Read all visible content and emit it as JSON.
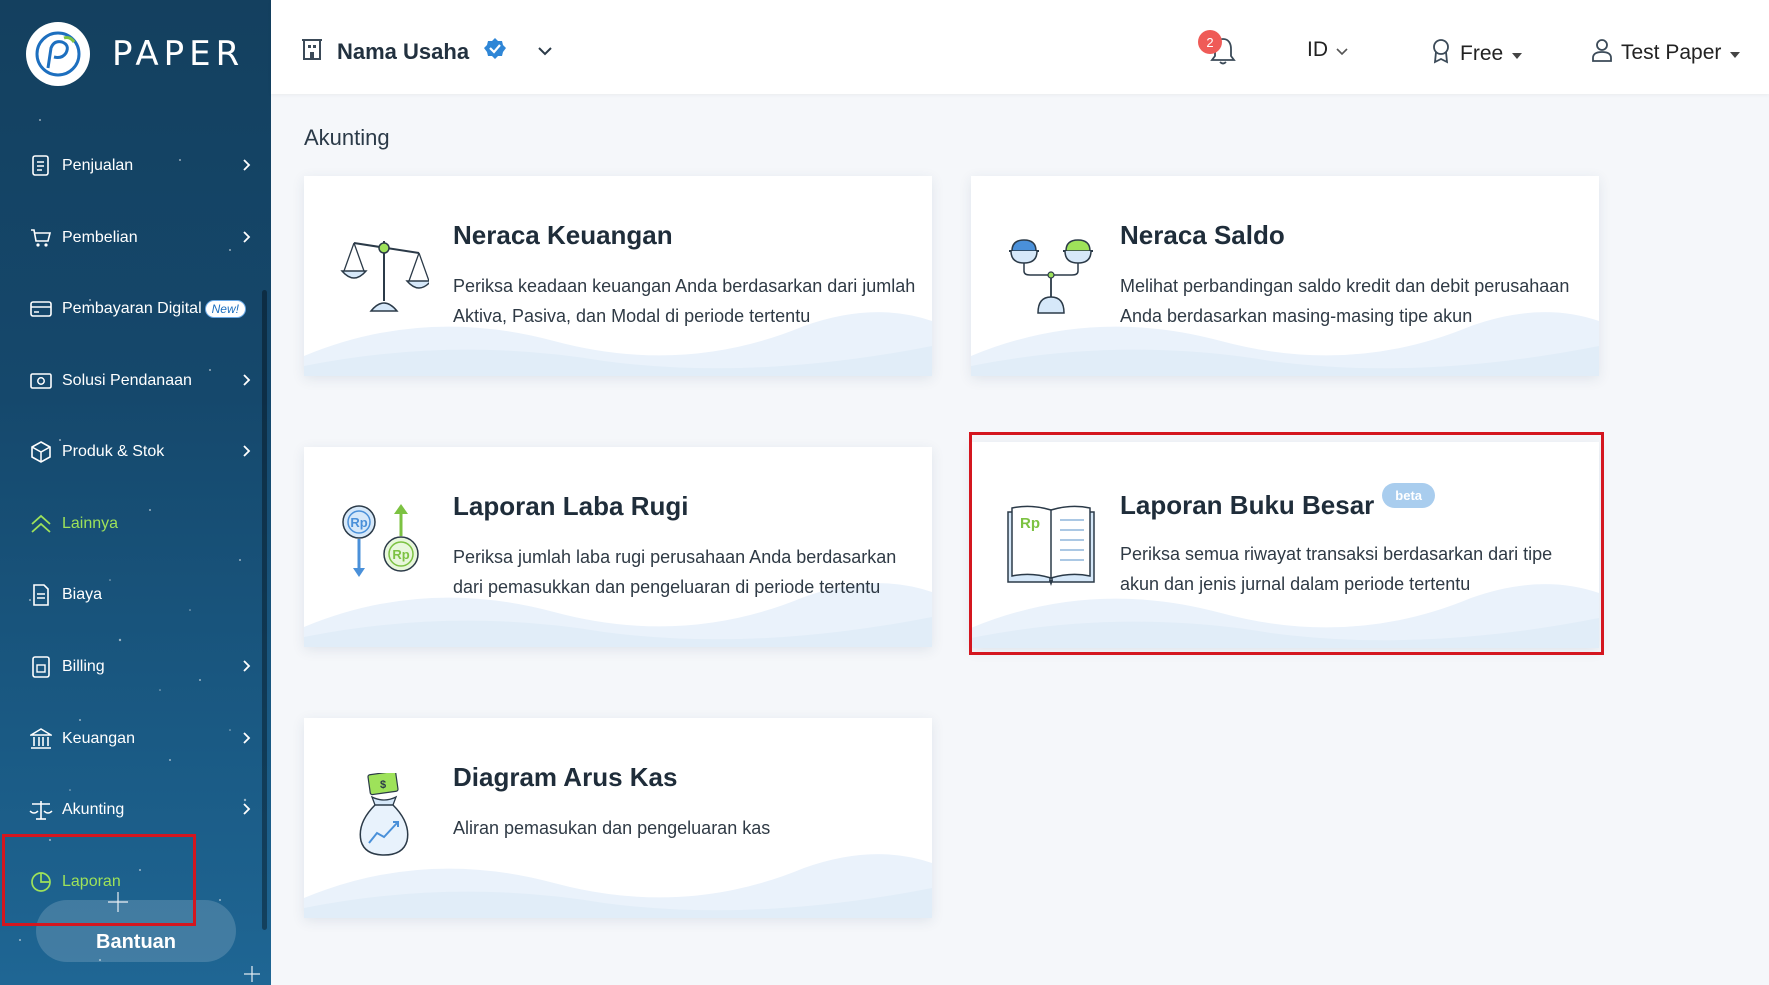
{
  "app": {
    "logo_text": "PAPER"
  },
  "sidebar": {
    "items": [
      {
        "label": "Penjualan",
        "icon": "invoice-icon",
        "has_chevron": true
      },
      {
        "label": "Pembelian",
        "icon": "cart-icon",
        "has_chevron": true
      },
      {
        "label": "Pembayaran Digital",
        "icon": "card-icon",
        "badge": "New!"
      },
      {
        "label": "Solusi Pendanaan",
        "icon": "cash-icon",
        "has_chevron": true
      },
      {
        "label": "Produk & Stok",
        "icon": "box-icon",
        "has_chevron": true
      },
      {
        "label": "Lainnya",
        "icon": "chevron-up-double-icon",
        "active": true
      },
      {
        "label": "Biaya",
        "icon": "receipt-icon"
      },
      {
        "label": "Billing",
        "icon": "billing-icon",
        "has_chevron": true
      },
      {
        "label": "Keuangan",
        "icon": "bank-icon",
        "has_chevron": true
      },
      {
        "label": "Akunting",
        "icon": "scale-icon",
        "has_chevron": true
      },
      {
        "label": "Laporan",
        "icon": "pie-chart-icon",
        "active": true
      }
    ],
    "help_button": "Bantuan"
  },
  "header": {
    "business_name": "Nama Usaha",
    "notification_count": "2",
    "language": "ID",
    "plan": "Free",
    "user": "Test Paper"
  },
  "main": {
    "section_title": "Akunting",
    "cards": [
      {
        "title": "Neraca Keuangan",
        "desc": "Periksa keadaan keuangan Anda berdasarkan dari jumlah Aktiva, Pasiva, dan Modal di periode tertentu",
        "icon": "balance-scale-icon"
      },
      {
        "title": "Neraca Saldo",
        "desc": "Melihat perbandingan saldo kredit dan debit perusahaan Anda berdasarkan masing-masing tipe akun",
        "icon": "trial-balance-icon"
      },
      {
        "title": "Laporan Laba Rugi",
        "desc": "Periksa jumlah laba rugi perusahaan Anda berdasarkan dari pemasukkan dan pengeluaran di periode tertentu",
        "icon": "profit-loss-icon"
      },
      {
        "title": "Laporan Buku Besar",
        "badge": "beta",
        "desc": "Periksa semua riwayat transaksi berdasarkan dari tipe akun dan jenis jurnal dalam periode tertentu",
        "icon": "ledger-book-icon",
        "highlighted": true
      },
      {
        "title": "Diagram Arus Kas",
        "desc": "Aliran pemasukan dan pengeluaran kas",
        "icon": "money-bag-icon"
      }
    ]
  },
  "colors": {
    "sidebar": "#15486c",
    "active": "#9ee25a",
    "highlight": "#d4161f",
    "badge": "#ef5b57"
  }
}
